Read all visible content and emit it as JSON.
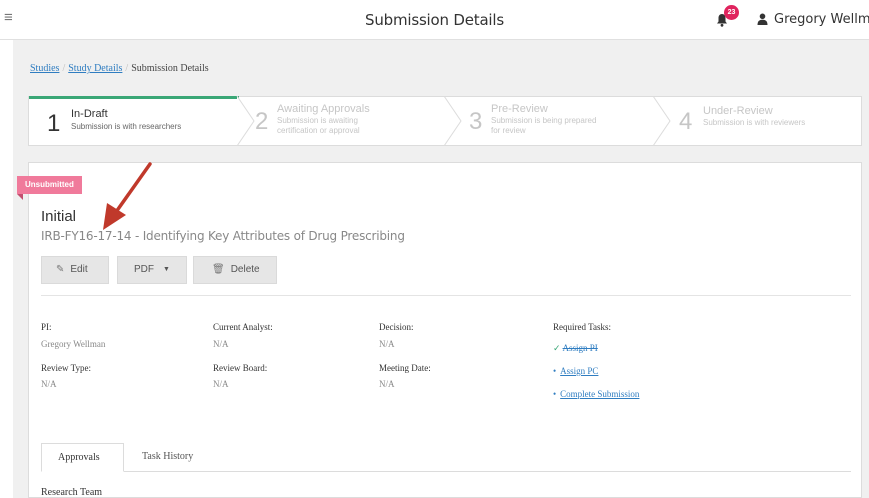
{
  "header": {
    "title": "Submission Details",
    "notification_count": "23",
    "user_name": "Gregory Wellman"
  },
  "breadcrumb": {
    "items": [
      "Studies",
      "Study Details"
    ],
    "current": "Submission Details"
  },
  "steps": [
    {
      "num": "1",
      "title": "In-Draft",
      "sub1": "Submission is with researchers",
      "sub2": ""
    },
    {
      "num": "2",
      "title": "Awaiting Approvals",
      "sub1": "Submission is awaiting",
      "sub2": "certification or approval"
    },
    {
      "num": "3",
      "title": "Pre-Review",
      "sub1": "Submission is being prepared",
      "sub2": "for review"
    },
    {
      "num": "4",
      "title": "Under-Review",
      "sub1": "Submission is with reviewers",
      "sub2": ""
    }
  ],
  "submission": {
    "status_badge": "Unsubmitted",
    "type": "Initial",
    "identifier": "IRB-FY16-17-14 - Identifying Key Attributes of Drug Prescribing"
  },
  "actions": {
    "edit": "Edit",
    "pdf": "PDF",
    "delete": "Delete"
  },
  "details": {
    "pi_label": "PI:",
    "pi_value": "Gregory Wellman",
    "analyst_label": "Current Analyst:",
    "analyst_value": "N/A",
    "decision_label": "Decision:",
    "decision_value": "N/A",
    "review_type_label": "Review Type:",
    "review_type_value": "N/A",
    "review_board_label": "Review Board:",
    "review_board_value": "N/A",
    "meeting_date_label": "Meeting Date:",
    "meeting_date_value": "N/A"
  },
  "required_tasks": {
    "label": "Required Tasks:",
    "items": [
      {
        "label": "Assign PI",
        "done": true
      },
      {
        "label": "Assign PC",
        "done": false
      },
      {
        "label": "Complete Submission",
        "done": false
      }
    ]
  },
  "tabs": [
    "Approvals",
    "Task History"
  ],
  "section": {
    "title": "Research Team"
  },
  "colors": {
    "accent_green": "#3aa776",
    "link_blue": "#2f7dc1",
    "badge_pink": "#f07a9b",
    "annotation_arrow": "#c0392b"
  }
}
